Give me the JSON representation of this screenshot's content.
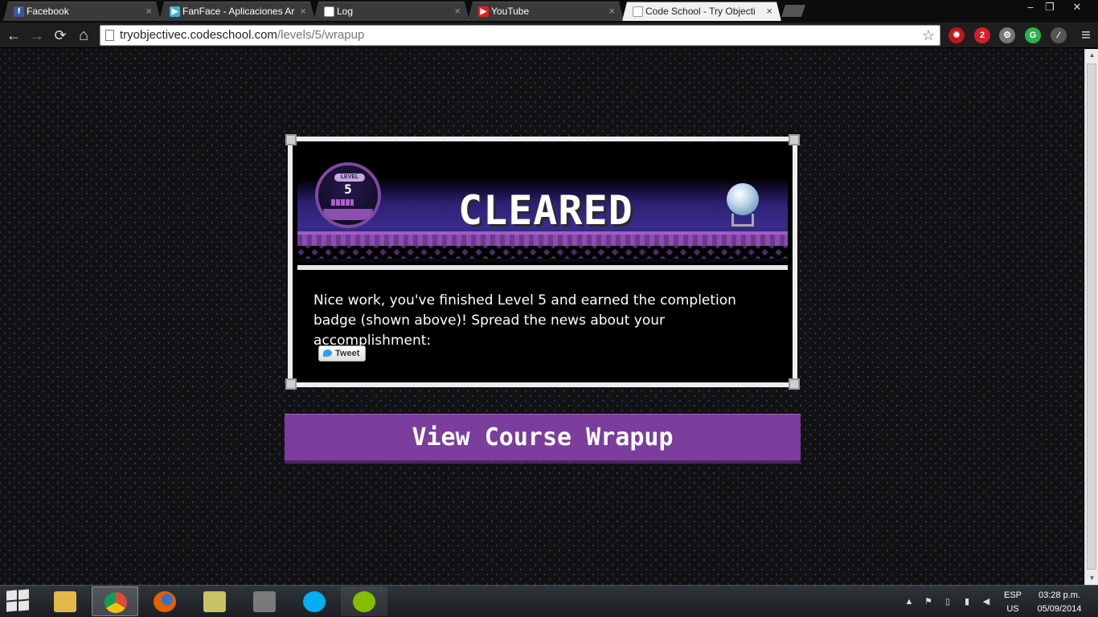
{
  "tabs": [
    {
      "label": "Facebook",
      "icon": "facebook-icon",
      "color": "#3b5998",
      "glyph": "f"
    },
    {
      "label": "FanFace - Aplicaciones Ar",
      "icon": "play-store-icon",
      "color": "#3fb5d6",
      "glyph": "▶"
    },
    {
      "label": "Log",
      "icon": "document-icon",
      "color": "#ffffff",
      "glyph": ""
    },
    {
      "label": "YouTube",
      "icon": "youtube-icon",
      "color": "#e62117",
      "glyph": "▶"
    },
    {
      "label": "Code School - Try Objecti",
      "icon": "document-icon",
      "color": "#ffffff",
      "glyph": ""
    }
  ],
  "tab_close_glyph": "×",
  "window": {
    "minimize": "–",
    "restore": "❐",
    "close": "✕"
  },
  "toolbar": {
    "back": "←",
    "forward": "→",
    "reload": "⟳",
    "home": "⌂",
    "url_host": "tryobjectivec.codeschool.com",
    "url_path": "/levels/5/wrapup",
    "star": "☆",
    "menu": "≡"
  },
  "extensions": [
    {
      "name": "extension-red-icon",
      "color": "#c0161c",
      "glyph": "✹"
    },
    {
      "name": "extension-badge-icon",
      "color": "#d0202a",
      "glyph": "2"
    },
    {
      "name": "extension-gear-icon",
      "color": "#777777",
      "glyph": "⚙"
    },
    {
      "name": "extension-green-icon",
      "color": "#2bb24c",
      "glyph": "G"
    },
    {
      "name": "extension-wand-icon",
      "color": "#555555",
      "glyph": "⁄"
    }
  ],
  "card": {
    "level_tag": "LEVEL",
    "level_number": "5",
    "banner_title": "CLEARED",
    "message": "Nice work, you've finished Level 5 and earned the completion badge (shown above)! Spread the news about your accomplishment:",
    "tweet_label": "Tweet"
  },
  "wrapup_button": "View Course Wrapup",
  "taskbar": {
    "apps": [
      {
        "name": "taskbar-file-explorer",
        "color": "#e3b84b"
      },
      {
        "name": "taskbar-chrome",
        "color": "#dd4b39",
        "active": true
      },
      {
        "name": "taskbar-firefox",
        "color": "#e66000"
      },
      {
        "name": "taskbar-folder",
        "color": "#c9c267"
      },
      {
        "name": "taskbar-sublime",
        "color": "#7a7a7a"
      },
      {
        "name": "taskbar-skype",
        "color": "#00aff0"
      },
      {
        "name": "taskbar-spotify",
        "color": "#84bd00"
      }
    ],
    "lang_top": "ESP",
    "lang_bottom": "US",
    "time": "03:28 p.m.",
    "date": "05/09/2014",
    "tray_expand": "▲"
  },
  "scrollbar": {
    "up": "▲",
    "down": "▼"
  }
}
